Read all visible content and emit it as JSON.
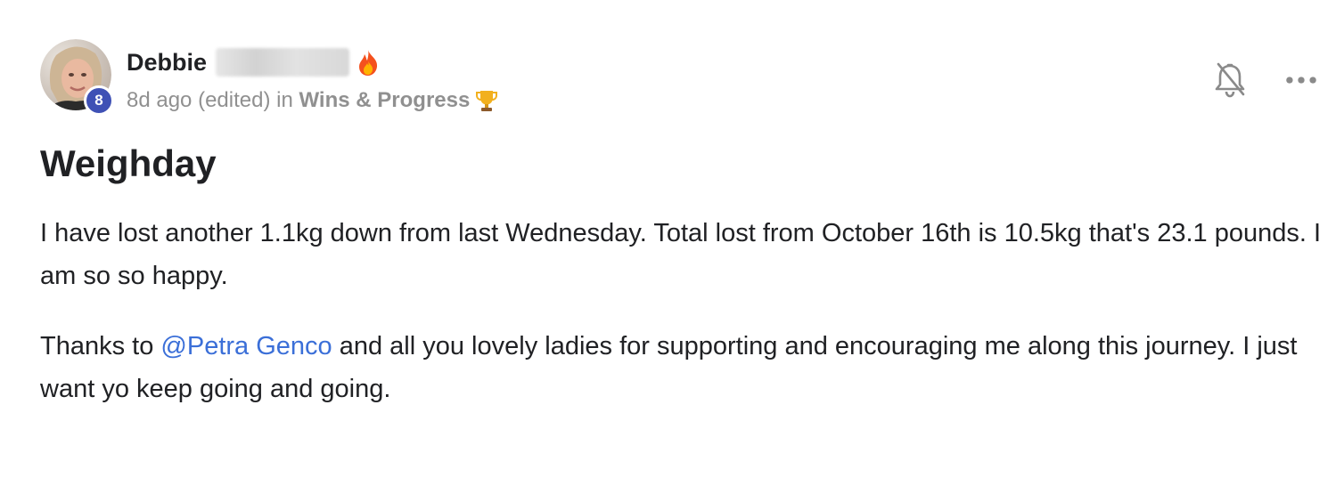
{
  "post": {
    "author": {
      "first_name": "Debbie",
      "level": "8"
    },
    "meta": {
      "time": "8d ago",
      "edited": "(edited)",
      "in_word": "in",
      "category": "Wins & Progress"
    },
    "title": "Weighday",
    "body": {
      "p1": "I have lost another 1.1kg down from last Wednesday. Total lost from October 16th is 10.5kg that's 23.1 pounds. I am so so happy.",
      "p2_before": "Thanks to ",
      "p2_mention": "@Petra Genco",
      "p2_after": " and all you lovely ladies for supporting and encouraging me along this journey. I just want yo keep going and going."
    },
    "icons": {
      "name_emoji": "fire-icon",
      "category_emoji": "trophy-icon",
      "notifications": "bell-off-icon",
      "menu": "more-horizontal-icon"
    },
    "colors": {
      "mention": "#3b6fd8",
      "level_badge": "#3f51b5",
      "meta_text": "#909090"
    }
  }
}
